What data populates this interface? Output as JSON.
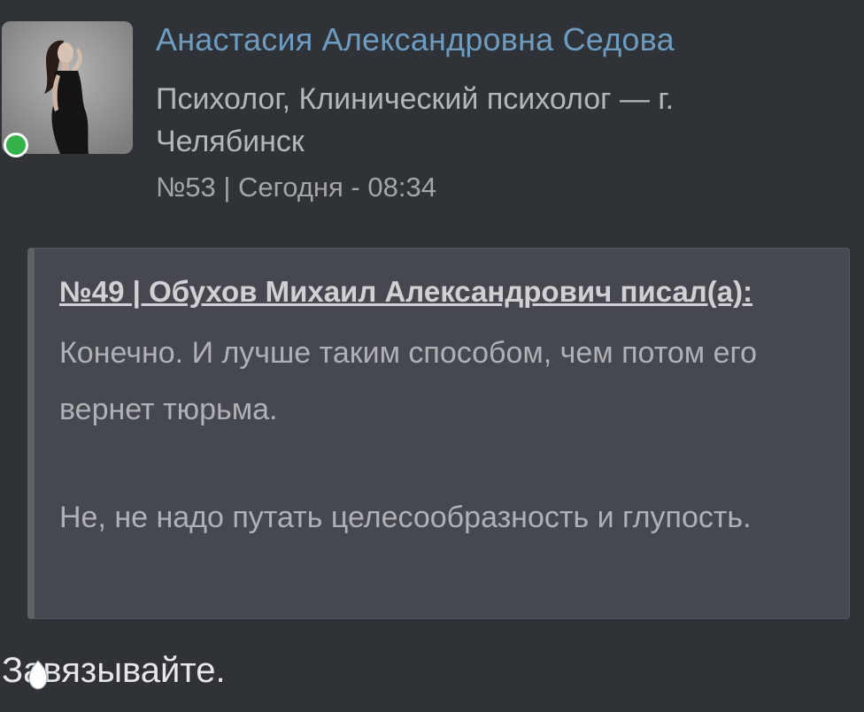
{
  "author": {
    "name": "Анастасия Александровна Седова",
    "role": "Психолог, Клинический психолог — г. Челябинск",
    "status": "online",
    "avatar_icon": "user-avatar-photo"
  },
  "post": {
    "meta": "№53 | Сегодня - 08:34"
  },
  "quote": {
    "header": "№49 | Обухов Михаил Александрович писал(а):",
    "paragraphs": [
      "Конечно. И лучше таким способом, чем потом его вернет тюрьма.",
      "Не, не надо путать целесообразность и глупость."
    ]
  },
  "reply": {
    "text": "Завязывайте."
  },
  "colors": {
    "background": "#2f3237",
    "author_name": "#6e9bc0",
    "online": "#35b34a",
    "quote_bg": "#45484e"
  }
}
